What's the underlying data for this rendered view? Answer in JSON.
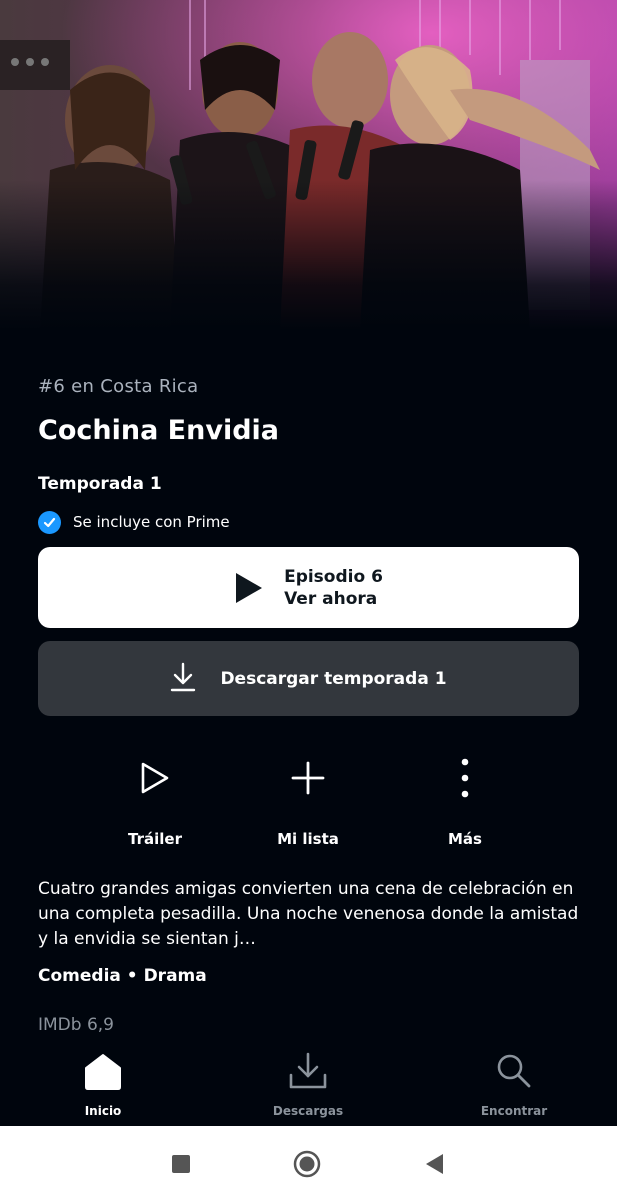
{
  "hero": {
    "image_alt": ""
  },
  "details": {
    "rank": "#6 en Costa Rica",
    "title": "Cochina Envidia",
    "season": "Temporada 1",
    "included_text": "Se incluye con Prime"
  },
  "play_button": {
    "line1": "Episodio 6",
    "line2": "Ver ahora"
  },
  "download_button": {
    "label": "Descargar temporada 1"
  },
  "actions": [
    {
      "label": "Tráiler",
      "icon": "play-outline-icon"
    },
    {
      "label": "Mi lista",
      "icon": "plus-icon"
    },
    {
      "label": "Más",
      "icon": "more-vertical-icon"
    }
  ],
  "synopsis": "Cuatro grandes amigas convierten una cena de celebración en una completa pesadilla. Una noche venenosa donde la amistad y la envidia se sientan j…",
  "genres": "Comedia • Drama",
  "imdb": "IMDb 6,9",
  "bottom_nav": [
    {
      "label": "Inicio",
      "icon": "home-icon",
      "active": true
    },
    {
      "label": "Descargas",
      "icon": "download-icon",
      "active": false
    },
    {
      "label": "Encontrar",
      "icon": "search-icon",
      "active": false
    }
  ],
  "colors": {
    "background": "#00050d",
    "accent_blue": "#1a98ff",
    "button_white": "#ffffff",
    "button_gray": "#33373d",
    "muted_text": "#8b939c"
  }
}
